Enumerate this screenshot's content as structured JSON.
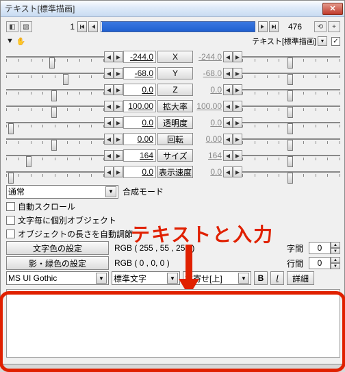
{
  "title": "テキスト[標準描画]",
  "topbar": {
    "frame_current": "1",
    "frame_total": "476",
    "arrow_l2": "◀◀",
    "arrow_l1": "◀",
    "arrow_r1": "▶",
    "arrow_r2": "▶▶",
    "layer_icon": "⟲",
    "plus": "+"
  },
  "header2": {
    "mode_label": "テキスト[標準描画]",
    "expand": "▼",
    "hand": "✋"
  },
  "params": [
    {
      "name": "X",
      "val": "-244.0",
      "val2": "-244.0"
    },
    {
      "name": "Y",
      "val": "-68.0",
      "val2": "-68.0"
    },
    {
      "name": "Z",
      "val": "0.0",
      "val2": "0.0"
    },
    {
      "name": "拡大率",
      "val": "100.00",
      "val2": "100.00"
    },
    {
      "name": "透明度",
      "val": "0.0",
      "val2": "0.0"
    },
    {
      "name": "回転",
      "val": "0.00",
      "val2": "0.00"
    },
    {
      "name": "サイズ",
      "val": "164",
      "val2": "164"
    },
    {
      "name": "表示速度",
      "val": "0.0",
      "val2": "0.0"
    }
  ],
  "blend": {
    "combo": "通常",
    "label": "合成モード"
  },
  "checks": {
    "autoscroll": "自動スクロール",
    "perchar": "文字毎に個別オブジェクト",
    "autolen": "オブジェクトの長さを自動調節"
  },
  "color": {
    "text_btn": "文字色の設定",
    "text_val": "RGB ( 255 ,  55 , 255 )",
    "shadow_btn": "影・緑色の設定",
    "shadow_val": "RGB ( 0 , 0, 0 )"
  },
  "spacing": {
    "char_label": "字間",
    "char_val": "0",
    "line_label": "行間",
    "line_val": "0"
  },
  "fontrow": {
    "font": "MS UI Gothic",
    "type": "標準文字",
    "align": "左寄せ[上]",
    "b": "B",
    "i": "I",
    "detail": "詳細"
  },
  "overlay": {
    "text": "テキストと入力"
  },
  "textarea": {
    "value": ""
  }
}
